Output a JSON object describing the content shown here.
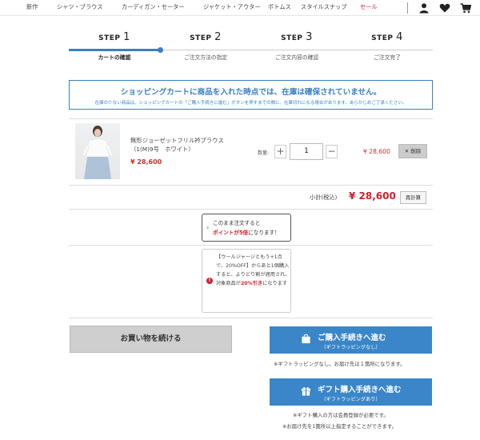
{
  "nav": {
    "items": [
      {
        "label": "新作"
      },
      {
        "label": "シャツ・ブラウス"
      },
      {
        "label": "カーディガン・セーター"
      },
      {
        "label": "ジャケット・アウター"
      },
      {
        "label": "ボトムス"
      },
      {
        "label": "スタイルスナップ"
      },
      {
        "label": "セール"
      }
    ],
    "icons": [
      "user-icon",
      "heart-icon",
      "cart-icon"
    ]
  },
  "steps": [
    {
      "prefix": "STEP",
      "num": "1",
      "label": "カートの確認",
      "active": true
    },
    {
      "prefix": "STEP",
      "num": "2",
      "label": "ご注文方法の指定",
      "active": false
    },
    {
      "prefix": "STEP",
      "num": "3",
      "label": "ご注文内容の確認",
      "active": false
    },
    {
      "prefix": "STEP",
      "num": "4",
      "label": "ご注文完了",
      "active": false
    }
  ],
  "notice": {
    "title": "ショッピングカートに商品を入れた時点では、在庫は確保されていません。",
    "sub": "在庫の少ない商品は、ショッピングカートの「ご購入手続きに進む」ボタンを押すまでの間に、在庫切れになる場合があります。あらかじめご了承ください。"
  },
  "cart": {
    "item": {
      "name_line1": "無形ジョーゼットフリル衿ブラウス",
      "name_line2": "（1(M)9号　ホワイト）",
      "price": "¥ 28,600",
      "qty_label": "数量:",
      "qty_minus": "−",
      "qty_plus": "+",
      "qty": "1",
      "row_price": "¥ 28,600",
      "delete_label": "✕ 削除"
    },
    "subtotal_label": "小計(税込)",
    "subtotal_value": "¥ 28,600",
    "recalc_label": "再計算"
  },
  "point": {
    "line1": "このまま注文すると",
    "highlight": "ポイントが5倍",
    "line2_rest": "になります！",
    "arrow": "›"
  },
  "campaign": {
    "icon": "!",
    "text_line1": "【ウールジャージともう+1点で、20%OFF】からあと1個購入すると、よりどり割が適用され、",
    "text_line2_prefix": "対象商品が",
    "text_line2_highlight": "20%引き",
    "text_line2_suffix": "になります"
  },
  "buttons": {
    "continue_label": "お買い物を続ける",
    "checkout_main": "ご購入手続きへ進む",
    "checkout_sub": "（ギフトラッピングなし）",
    "checkout_note": "※ギフトラッピングなし。お届け先は１箇所になります。",
    "gift_main": "ギフト購入手続きへ進む",
    "gift_sub": "（ギフトラッピングあり）",
    "gift_note1": "※ギフト購入の方は会員登録が必要です。",
    "gift_note2": "※お届け先を1箇所以上指定することができます。"
  },
  "colors": {
    "accent": "#3a86c8",
    "sale": "#d0202b"
  }
}
